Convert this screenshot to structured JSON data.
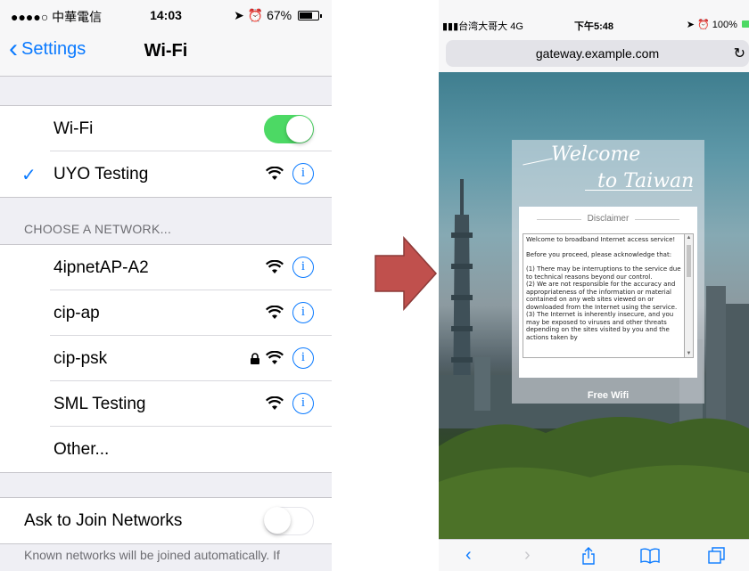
{
  "left": {
    "status": {
      "carrier": "●●●●○ 中華電信",
      "time": "14:03",
      "battery": "67%"
    },
    "nav": {
      "back_label": "Settings",
      "title": "Wi-Fi"
    },
    "wifi_row": {
      "label": "Wi-Fi",
      "on": true
    },
    "connected": {
      "label": "UYO Testing",
      "info": "i"
    },
    "section_header": "CHOOSE A NETWORK...",
    "networks": [
      {
        "label": "4ipnetAP-A2",
        "locked": false
      },
      {
        "label": "cip-ap",
        "locked": false
      },
      {
        "label": "cip-psk",
        "locked": true
      },
      {
        "label": "SML Testing",
        "locked": false
      }
    ],
    "other": "Other...",
    "ask_join": {
      "label": "Ask to Join Networks",
      "on": false
    },
    "footer": "Known networks will be joined automatically. If"
  },
  "right": {
    "status": {
      "carrier": "台湾大哥大 4G",
      "time": "下午5:48",
      "battery": "100%"
    },
    "url": "gateway.example.com",
    "welcome_line1": "Welcome",
    "welcome_line2": "to Taiwan",
    "disclaimer_title": "Disclaimer",
    "disclaimer_paragraphs": [
      "Welcome to broadband Internet access service!",
      "Before you proceed, please acknowledge that:",
      "(1) There may be interruptions to the service due to technical reasons beyond our control.",
      "(2) We are not responsible for the accuracy and appropriateness of the information or material contained on any web sites viewed on or downloaded from the Internet using the service.",
      "(3) The Internet is inherently insecure, and you may be exposed to viruses and other threats depending on the sites visited by you and the actions taken by"
    ],
    "free_wifi_button": "Free Wifi"
  },
  "colors": {
    "accent_blue": "#0a7aff",
    "toggle_green": "#4cd964",
    "arrow_red": "#c0504d"
  }
}
